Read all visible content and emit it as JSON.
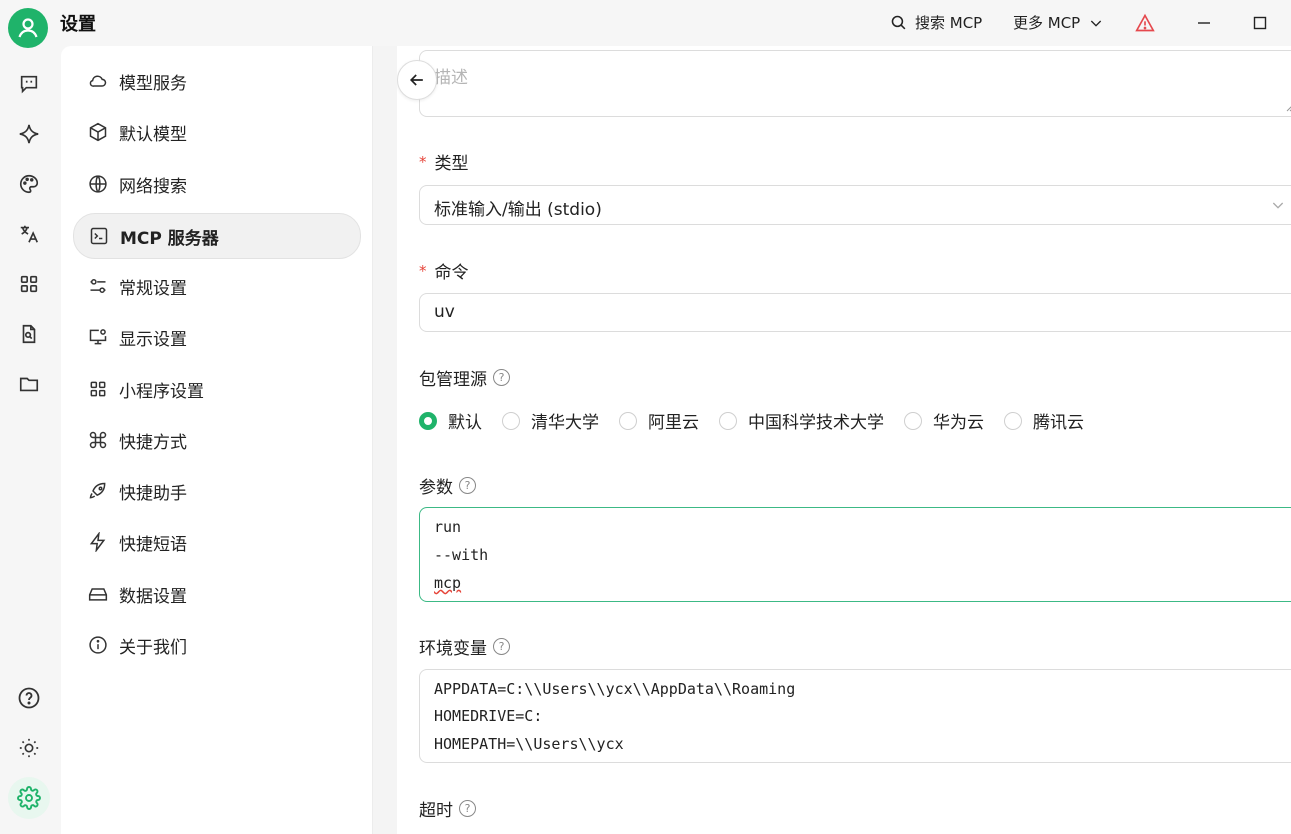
{
  "header": {
    "title": "设置",
    "search_mcp": "搜索 MCP",
    "more_mcp": "更多 MCP"
  },
  "settings_nav": {
    "items": [
      {
        "label": "模型服务",
        "icon": "cloud-icon"
      },
      {
        "label": "默认模型",
        "icon": "cube-icon"
      },
      {
        "label": "网络搜索",
        "icon": "globe-icon"
      },
      {
        "label": "MCP 服务器",
        "icon": "terminal-icon",
        "active": true
      },
      {
        "label": "常规设置",
        "icon": "sliders-icon"
      },
      {
        "label": "显示设置",
        "icon": "monitor-icon"
      },
      {
        "label": "小程序设置",
        "icon": "grid-icon"
      },
      {
        "label": "快捷方式",
        "icon": "command-icon"
      },
      {
        "label": "快捷助手",
        "icon": "rocket-icon"
      },
      {
        "label": "快捷短语",
        "icon": "zap-icon"
      },
      {
        "label": "数据设置",
        "icon": "drive-icon"
      },
      {
        "label": "关于我们",
        "icon": "info-icon"
      }
    ]
  },
  "form": {
    "description_placeholder": "描述",
    "type_label": "类型",
    "type_value": "标准输入/输出 (stdio)",
    "command_label": "命令",
    "command_value": "uv",
    "registry_label": "包管理源",
    "registry_options": [
      "默认",
      "清华大学",
      "阿里云",
      "中国科学技术大学",
      "华为云",
      "腾讯云"
    ],
    "registry_selected": "默认",
    "args_label": "参数",
    "args_lines": [
      "run",
      "--with",
      "mcp"
    ],
    "env_label": "环境变量",
    "env_lines": [
      "APPDATA=C:\\\\Users\\\\ycx\\\\AppData\\\\Roaming",
      "HOMEDRIVE=C:",
      "HOMEPATH=\\\\Users\\\\ycx"
    ],
    "timeout_label": "超时"
  },
  "colors": {
    "accent": "#1fb36a",
    "required": "#e6453a",
    "warning": "#e5484d"
  }
}
